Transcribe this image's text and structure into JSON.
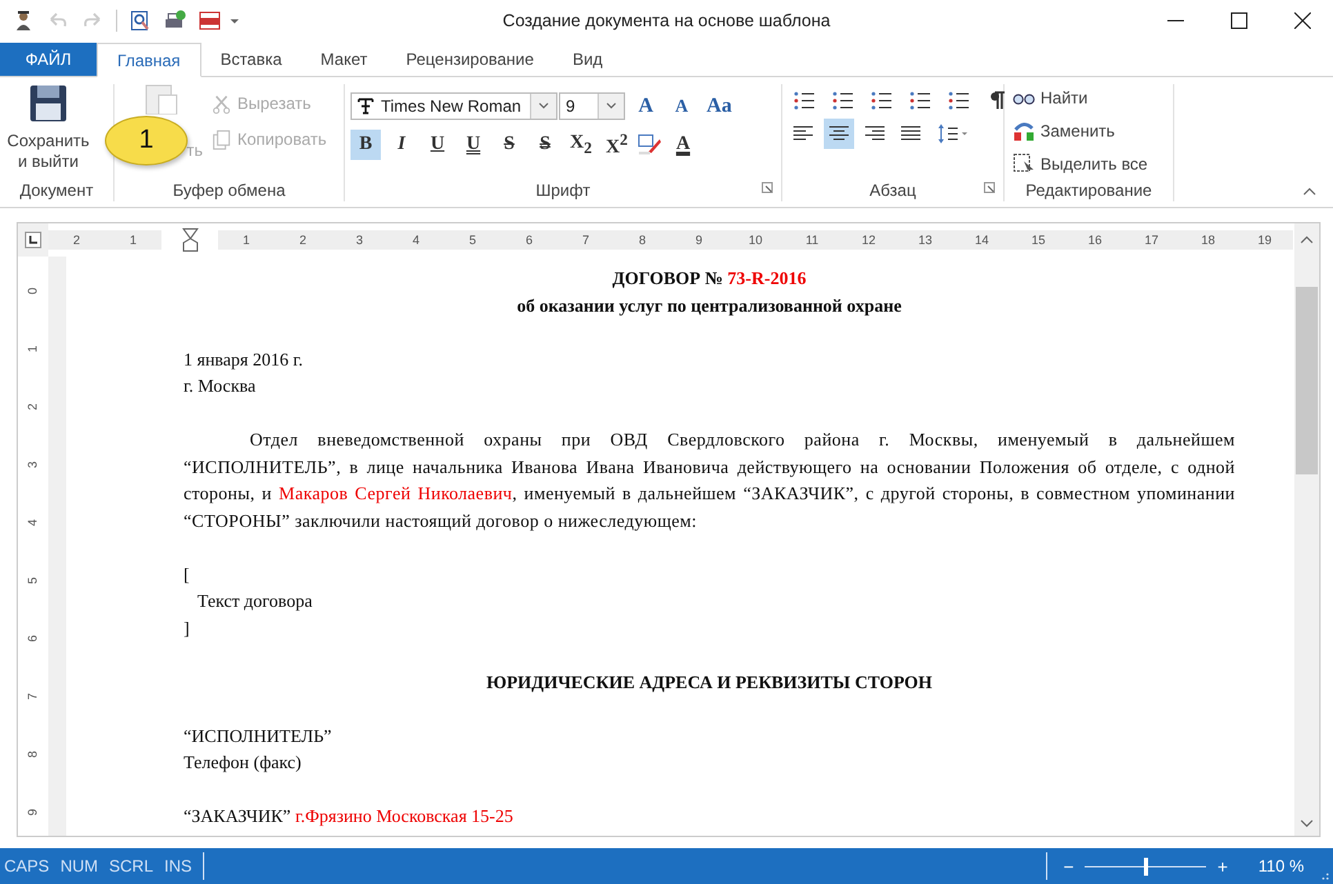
{
  "title_bar": {
    "title": "Создание документа на основе шаблона"
  },
  "ribbon_tabs": [
    {
      "label": "ФАЙЛ",
      "kind": "file",
      "selected": false
    },
    {
      "label": "Главная",
      "kind": "tab",
      "selected": true
    },
    {
      "label": "Вставка",
      "kind": "tab",
      "selected": false
    },
    {
      "label": "Макет",
      "kind": "tab",
      "selected": false
    },
    {
      "label": "Рецензирование",
      "kind": "tab",
      "selected": false
    },
    {
      "label": "Вид",
      "kind": "tab",
      "selected": false
    }
  ],
  "ribbon": {
    "document_group": {
      "label": "Документ",
      "save_button": "Сохранить и выйти"
    },
    "clipboard_group": {
      "label": "Буфер обмена",
      "paste_button": {
        "label": "ть",
        "disabled": true
      },
      "cut_button": {
        "label": "Вырезать",
        "disabled": true
      },
      "copy_button": {
        "label": "Копировать",
        "disabled": true
      }
    },
    "font_group": {
      "label": "Шрифт",
      "font_name": "Times New Roman",
      "font_size": "9",
      "grow_button": "A",
      "shrink_button": "A",
      "case_button": "Aa",
      "font_color_button": "A",
      "format_buttons": [
        {
          "kind": "bold",
          "label": "B",
          "selected": true
        },
        {
          "kind": "italic",
          "label": "I",
          "selected": false
        },
        {
          "kind": "underline",
          "label": "U",
          "selected": false
        },
        {
          "kind": "double-underline",
          "label": "U",
          "selected": false
        },
        {
          "kind": "strike",
          "label": "S",
          "selected": false
        },
        {
          "kind": "double-strike",
          "label": "S",
          "selected": false
        },
        {
          "kind": "subscript",
          "label": "X$_{2}$",
          "selected": false
        },
        {
          "kind": "superscript",
          "label": "X$^{2}$",
          "selected": false
        }
      ]
    },
    "paragraph_group": {
      "label": "Абзац",
      "align_buttons": [
        {
          "kind": "left",
          "selected": false
        },
        {
          "kind": "center",
          "selected": true
        },
        {
          "kind": "right",
          "selected": false
        },
        {
          "kind": "justify",
          "selected": false
        }
      ]
    },
    "editing_group": {
      "label": "Редактирование",
      "find_button": "Найти",
      "replace_button": "Заменить",
      "select_all_button": "Выделить все"
    }
  },
  "callout": {
    "label": "1"
  },
  "ruler": {
    "left_labels": [
      "2",
      "1"
    ],
    "labels": [
      "1",
      "2",
      "3",
      "4",
      "5",
      "6",
      "7",
      "8",
      "9",
      "10",
      "11",
      "12",
      "13",
      "14",
      "15",
      "16",
      "17",
      "18",
      "19"
    ]
  },
  "vertical_ruler": {
    "labels": [
      "0",
      "1",
      "2",
      "3",
      "4",
      "5",
      "6",
      "7",
      "8",
      "9"
    ]
  },
  "document": {
    "paragraphs": [
      {
        "kind": "heading",
        "space_before": false,
        "segments": [
          {
            "text": "ДОГОВОР № ",
            "field": false
          },
          {
            "text": "73-R-2016",
            "field": true
          }
        ]
      },
      {
        "kind": "heading",
        "space_before": false,
        "segments": [
          {
            "text": "об оказании услуг по централизованной охране",
            "field": false
          }
        ]
      },
      {
        "kind": "line",
        "space_before": true,
        "segments": [
          {
            "text": "1 января 2016 г.",
            "field": false
          }
        ]
      },
      {
        "kind": "line",
        "space_before": false,
        "segments": [
          {
            "text": "г. Москва",
            "field": false
          }
        ]
      },
      {
        "kind": "body",
        "space_before": true,
        "segments": [
          {
            "text": "Отдел вневедомственной охраны при ОВД Свердловского района г. Москвы, именуемый в дальнейшем “ИСПОЛНИТЕЛЬ”, в лице начальника Иванова Ивана Ивановича действующего на основании Положения об отделе, с одной стороны, и ",
            "field": false
          },
          {
            "text": "Макаров Сергей Николаевич",
            "field": true
          },
          {
            "text": ", именуемый в дальнейшем “ЗАКАЗЧИК”, с другой стороны, в совместном упоминании “СТОРОНЫ” заключили настоящий договор о нижеследующем:",
            "field": false
          }
        ]
      },
      {
        "kind": "line",
        "space_before": true,
        "segments": [
          {
            "text": "[",
            "field": false
          }
        ]
      },
      {
        "kind": "indented",
        "space_before": false,
        "segments": [
          {
            "text": "Текст договора",
            "field": false
          }
        ]
      },
      {
        "kind": "line",
        "space_before": false,
        "segments": [
          {
            "text": "]",
            "field": false
          }
        ]
      },
      {
        "kind": "heading",
        "space_before": true,
        "segments": [
          {
            "text": "ЮРИДИЧЕСКИЕ АДРЕСА И РЕКВИЗИТЫ СТОРОН",
            "field": false
          }
        ]
      },
      {
        "kind": "line",
        "space_before": true,
        "segments": [
          {
            "text": "“ИСПОЛНИТЕЛЬ”",
            "field": false
          }
        ]
      },
      {
        "kind": "line",
        "space_before": false,
        "segments": [
          {
            "text": "Телефон (факс)",
            "field": false
          }
        ]
      },
      {
        "kind": "line",
        "space_before": true,
        "segments": [
          {
            "text": "“ЗАКАЗЧИК” ",
            "field": false
          },
          {
            "text": "г.Фрязино Московская 15-25",
            "field": true
          }
        ]
      }
    ]
  },
  "status_bar": {
    "indicators": [
      {
        "label": "CAPS"
      },
      {
        "label": "NUM"
      },
      {
        "label": "SCRL"
      },
      {
        "label": "INS"
      }
    ],
    "zoom_out": "−",
    "zoom_in": "+",
    "zoom": {
      "level": 0.5,
      "reading": "110 %"
    }
  }
}
